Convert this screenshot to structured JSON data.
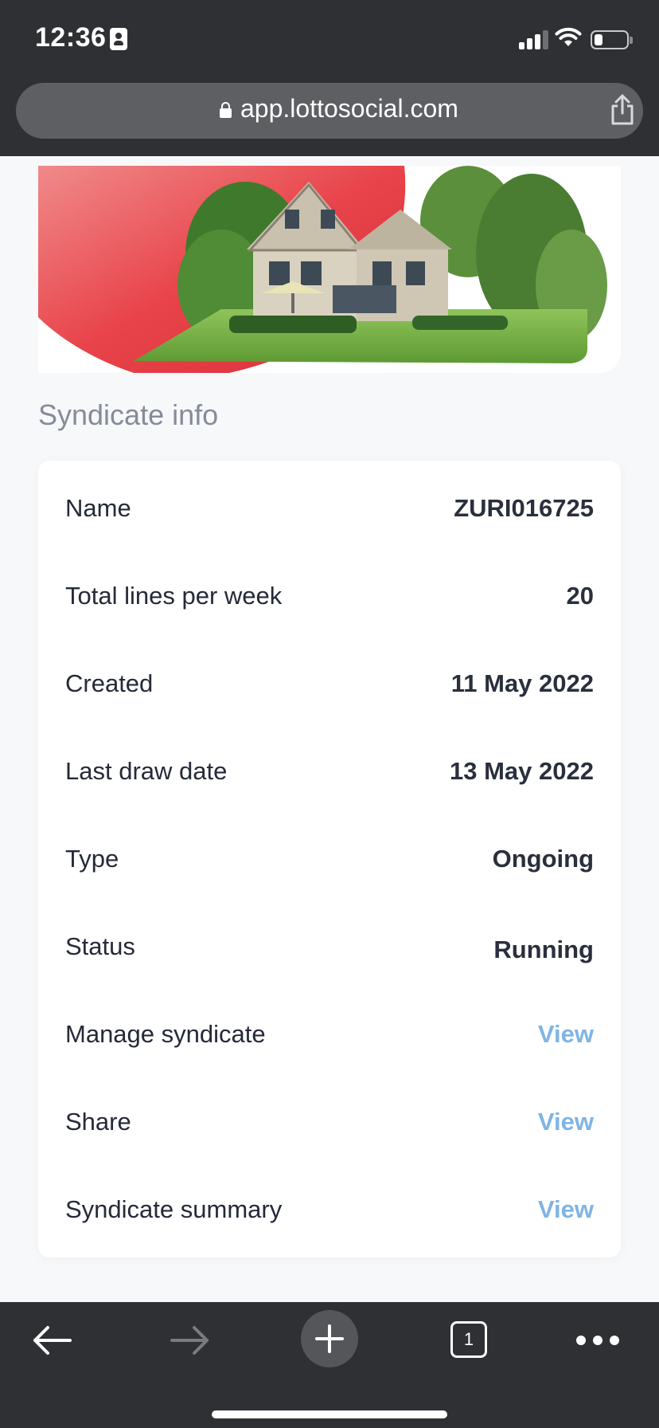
{
  "status_bar": {
    "time": "12:36",
    "icons": [
      "contact-card-icon",
      "cellular-signal-icon",
      "wifi-icon",
      "battery-icon"
    ]
  },
  "browser": {
    "url": "app.lottosocial.com",
    "icons": [
      "lock-icon",
      "share-icon"
    ]
  },
  "hero": {
    "image": "house-with-garden-banner",
    "accent_color": "#e8434a"
  },
  "syndicate_info": {
    "title": "Syndicate info",
    "rows": [
      {
        "label": "Name",
        "value": "ZURI016725"
      },
      {
        "label": "Total lines per week",
        "value": "20"
      },
      {
        "label": "Created",
        "value": "11 May 2022"
      },
      {
        "label": "Last draw date",
        "value": "13 May 2022"
      },
      {
        "label": "Type",
        "value": "Ongoing"
      },
      {
        "label": "Status",
        "value": "Running"
      },
      {
        "label": "Manage syndicate",
        "link": "View"
      },
      {
        "label": "Share",
        "link": "View"
      },
      {
        "label": "Syndicate summary",
        "link": "View"
      }
    ],
    "link_color": "#7fb4e6"
  },
  "toolbar": {
    "tab_count": "1",
    "icons": [
      "back-arrow-icon",
      "forward-arrow-icon",
      "new-tab-plus-icon",
      "tabs-icon",
      "more-icon"
    ]
  }
}
